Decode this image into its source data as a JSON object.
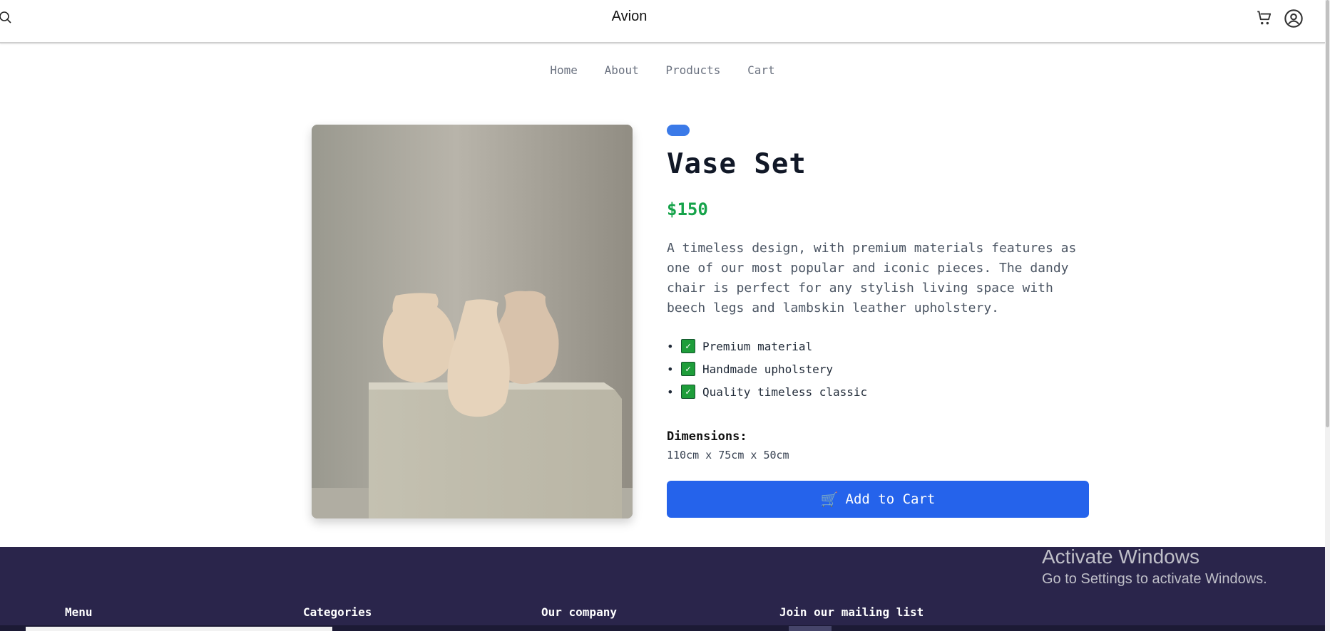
{
  "header": {
    "brand": "Avion",
    "icons": [
      "search-icon",
      "cart-icon",
      "user-icon"
    ]
  },
  "nav": {
    "items": [
      "Home",
      "About",
      "Products",
      "Cart"
    ]
  },
  "product": {
    "title": "Vase Set",
    "price": "$150",
    "description": "A timeless design, with premium materials features as one of our most popular and iconic pieces. The dandy chair is perfect for any stylish living space with beech legs and lambskin leather upholstery.",
    "features": [
      "Premium material",
      "Handmade upholstery",
      "Quality timeless classic"
    ],
    "dimensions_label": "Dimensions:",
    "dimensions_value": "110cm x 75cm x 50cm",
    "add_to_cart_label": "Add to Cart",
    "badge_color": "#3b7ae8",
    "price_color": "#16a34a",
    "button_color": "#2563eb"
  },
  "footer": {
    "columns": [
      "Menu",
      "Categories",
      "Our company",
      "Join our mailing list"
    ],
    "background": "#2a254b"
  },
  "watermark": {
    "title": "Activate Windows",
    "subtitle": "Go to Settings to activate Windows."
  }
}
